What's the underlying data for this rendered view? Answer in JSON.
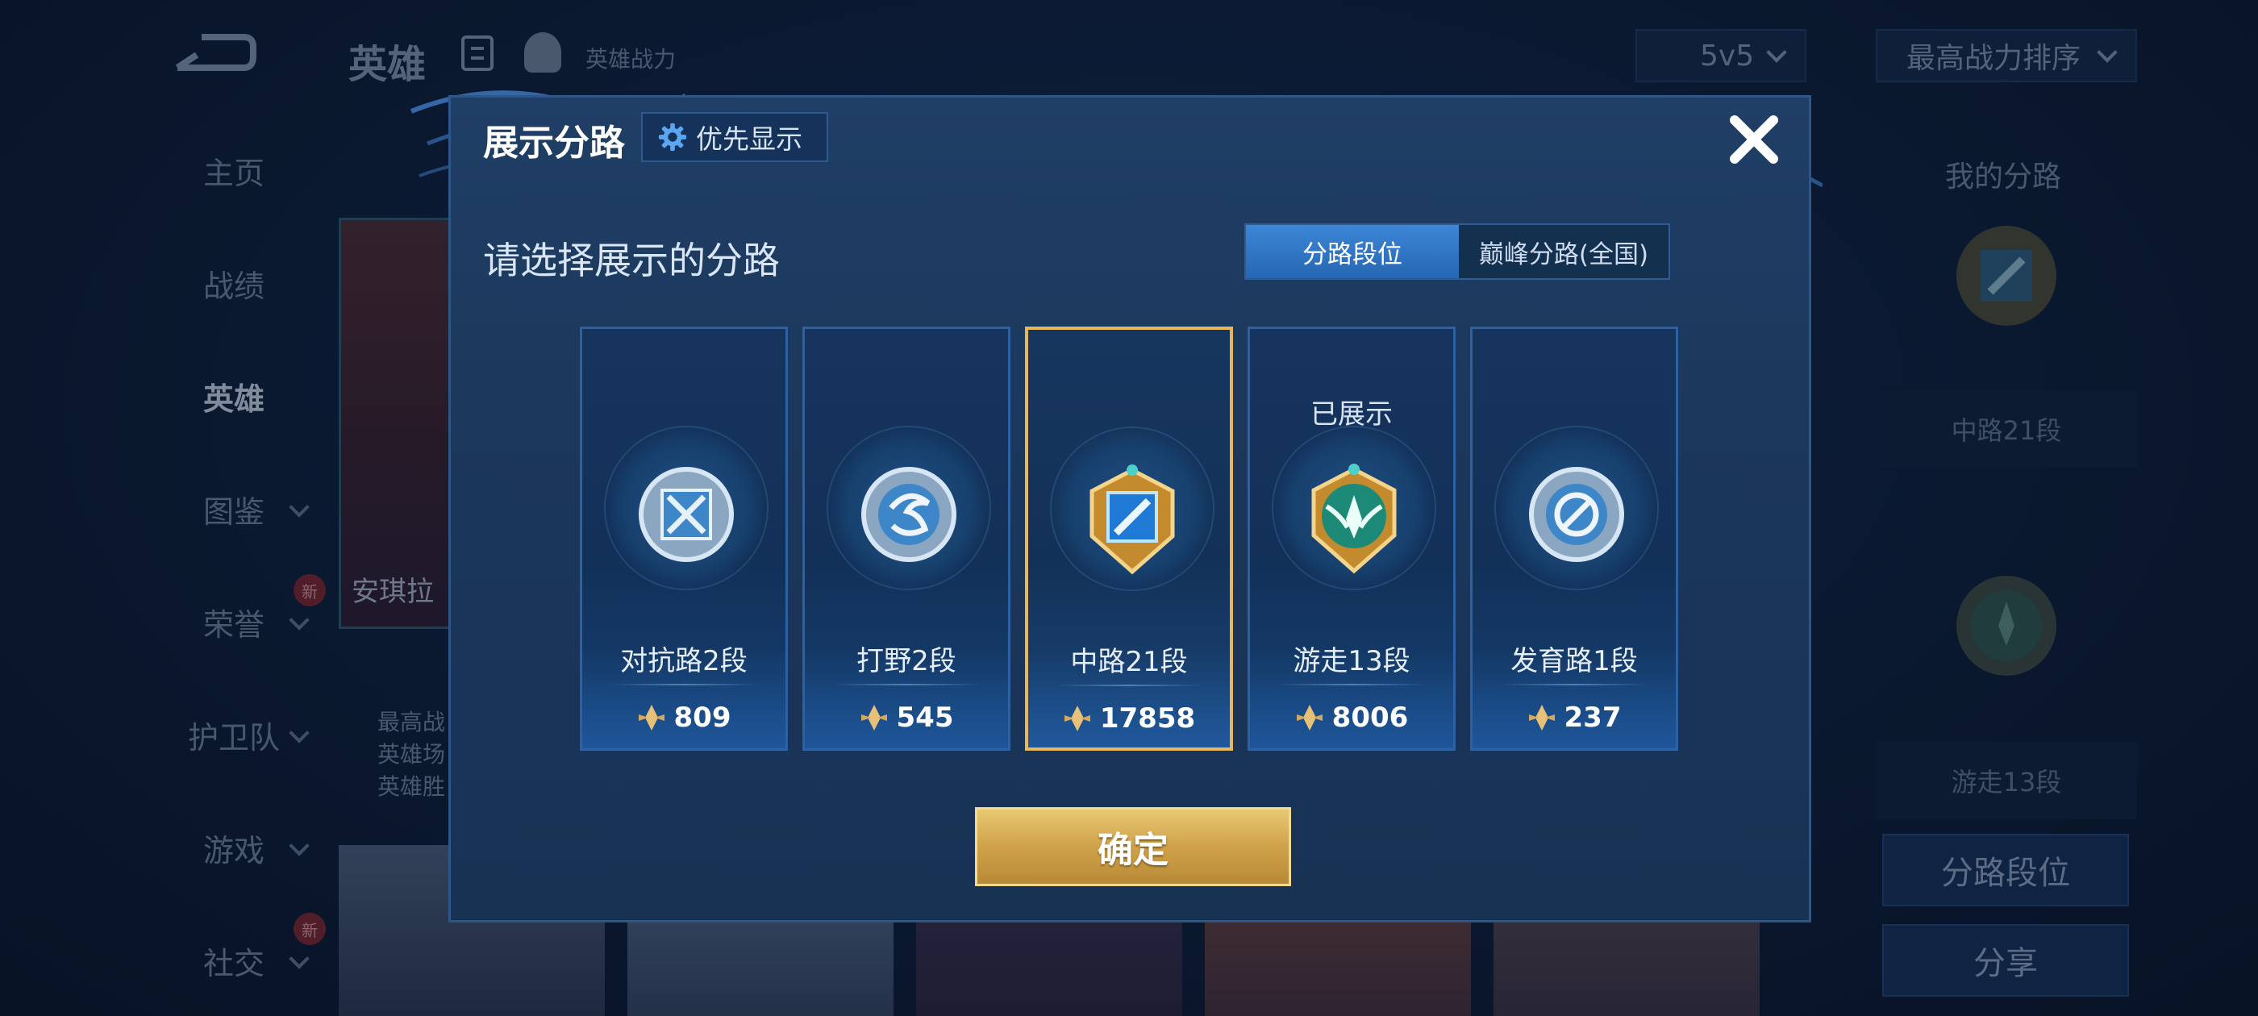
{
  "top_bar": {
    "title": "英雄",
    "power_label": "英雄战力",
    "mode_select": "5v5",
    "sort_select": "最高战力排序"
  },
  "sidebar": {
    "items": [
      {
        "label": "主页"
      },
      {
        "label": "战绩"
      },
      {
        "label": "英雄"
      },
      {
        "label": "图鉴"
      },
      {
        "label": "荣誉"
      },
      {
        "label": "护卫队"
      },
      {
        "label": "游戏"
      },
      {
        "label": "社交"
      }
    ],
    "active": "英雄",
    "new_badge": "新"
  },
  "hero": {
    "name": "安琪拉",
    "stats": [
      "最高战",
      "英雄场",
      "英雄胜"
    ]
  },
  "right_panel": {
    "title": "我的分路",
    "slot1_label": "中路21段",
    "slot2_label": "游走13段",
    "lane_rank_button": "分路段位",
    "share_button": "分享"
  },
  "modal": {
    "title": "展示分路",
    "priority_button": "优先显示",
    "subtitle": "请选择展示的分路",
    "tabs": [
      "分路段位",
      "巅峰分路(全国)"
    ],
    "active_tab": "分路段位",
    "lanes": [
      {
        "name": "对抗路2段",
        "score": "809",
        "icon": "sword-shield-icon",
        "tier": "silver",
        "shown": ""
      },
      {
        "name": "打野2段",
        "score": "545",
        "icon": "jungle-swirl-icon",
        "tier": "silver",
        "shown": ""
      },
      {
        "name": "中路21段",
        "score": "17858",
        "icon": "mid-lane-icon",
        "tier": "gold",
        "shown": ""
      },
      {
        "name": "游走13段",
        "score": "8006",
        "icon": "roam-wings-icon",
        "tier": "gold-green",
        "shown": "已展示"
      },
      {
        "name": "发育路1段",
        "score": "237",
        "icon": "farm-lane-icon",
        "tier": "silver",
        "shown": ""
      }
    ],
    "selected_lane": "中路21段",
    "confirm_button": "确定"
  }
}
